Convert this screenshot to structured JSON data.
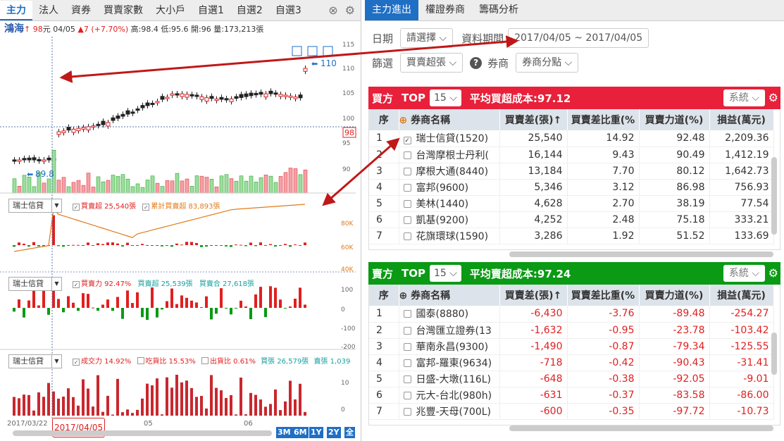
{
  "left_tabs": [
    "主力",
    "法人",
    "資券",
    "買賣家數",
    "大小戶",
    "自選1",
    "自選2",
    "自選3"
  ],
  "quote": {
    "name": "鴻海",
    "arrow": "↑",
    "price": "98",
    "unit": "元",
    "date": "04/05",
    "change": "▲7 (+7.70%)",
    "high": "高:98.4",
    "low": "低:95.6",
    "open": "開:96",
    "volume": "量:173,213張"
  },
  "price_axis": [
    "115",
    "110",
    "105",
    "100",
    "95",
    "90"
  ],
  "price_tags": {
    "last": "98",
    "high_mark": "110",
    "low_mark": "89.8"
  },
  "panel1": {
    "broker": "瑞士信貸",
    "legend1": "買賣超 25,540張",
    "legend2": "累計買賣超 83,893張",
    "axis": [
      "80K",
      "60K",
      "40K"
    ]
  },
  "panel2": {
    "broker": "瑞士信貸",
    "legend1": "買賣力 92.47%",
    "legend2": "買賣超 25,539張",
    "legend3": "買賣合 27,618張",
    "axis": [
      "100",
      "0",
      "-100",
      "-200"
    ]
  },
  "panel3": {
    "broker": "瑞士信貸",
    "legend1": "成交力 14.92%",
    "legend2": "吃貨比 15.53%",
    "legend3": "出貨比 0.61%",
    "legend4": "買張 26,579張",
    "legend5": "賣張 1,039",
    "axis": [
      "10",
      "0"
    ]
  },
  "date_axis": {
    "start": "2017/03/22",
    "selected": "2017/04/05",
    "m1": "05",
    "m2": "06"
  },
  "zoom_buttons": [
    "3M",
    "6M",
    "1Y",
    "2Y",
    "全"
  ],
  "right_tabs": [
    "主力進出",
    "權證券商",
    "籌碼分析"
  ],
  "filters": {
    "date_label": "日期",
    "date_select": "請選擇",
    "period_label": "資料期間",
    "period_value": "2017/04/05 ~ 2017/04/05",
    "filter_label": "篩選",
    "filter_select": "買賣超張",
    "broker_label": "券商",
    "broker_select": "券商分點"
  },
  "buy": {
    "side": "買方",
    "top": "TOP",
    "top_n": "15",
    "avg": "平均買超成本:97.12",
    "sys": "系統",
    "headers": [
      "序",
      "券商名稱",
      "買賣差(張)↑",
      "買賣差比重(%",
      "買賣力道(%)",
      "損益(萬元)"
    ],
    "rows": [
      [
        "1",
        "瑞士信貸(1520)",
        "25,540",
        "14.92",
        "92.48",
        "2,209.36"
      ],
      [
        "2",
        "台灣摩根士丹利(",
        "16,144",
        "9.43",
        "90.49",
        "1,412.19"
      ],
      [
        "3",
        "摩根大通(8440)",
        "13,184",
        "7.70",
        "80.12",
        "1,642.73"
      ],
      [
        "4",
        "富邦(9600)",
        "5,346",
        "3.12",
        "86.98",
        "756.93"
      ],
      [
        "5",
        "美林(1440)",
        "4,628",
        "2.70",
        "38.19",
        "77.54"
      ],
      [
        "6",
        "凱基(9200)",
        "4,252",
        "2.48",
        "75.18",
        "333.21"
      ],
      [
        "7",
        "花旗環球(1590)",
        "3,286",
        "1.92",
        "51.52",
        "133.69"
      ]
    ]
  },
  "sell": {
    "side": "賣方",
    "top": "TOP",
    "top_n": "15",
    "avg": "平均賣超成本:97.24",
    "sys": "系統",
    "headers": [
      "序",
      "券商名稱",
      "買賣差(張)↑",
      "買賣差比重(%",
      "買賣力道(%)",
      "損益(萬元)"
    ],
    "rows": [
      [
        "1",
        "國泰(8880)",
        "-6,430",
        "-3.76",
        "-89.48",
        "-254.27"
      ],
      [
        "2",
        "台灣匯立證券(13",
        "-1,632",
        "-0.95",
        "-23.78",
        "-103.42"
      ],
      [
        "3",
        "華南永昌(9300)",
        "-1,490",
        "-0.87",
        "-79.34",
        "-125.55"
      ],
      [
        "4",
        "富邦-羅東(9634)",
        "-718",
        "-0.42",
        "-90.43",
        "-31.41"
      ],
      [
        "5",
        "日盛-大墩(116L)",
        "-648",
        "-0.38",
        "-92.05",
        "-9.01"
      ],
      [
        "6",
        "元大-台北(980h)",
        "-631",
        "-0.37",
        "-83.58",
        "-86.00"
      ],
      [
        "7",
        "兆豐-天母(700L)",
        "-600",
        "-0.35",
        "-97.72",
        "-10.73"
      ]
    ]
  },
  "colors": {
    "buy_header": "#e8203a",
    "sell_header": "#0a9a14",
    "accent": "#1f6fc5",
    "up": "#e02020",
    "down": "#0a9a14"
  }
}
